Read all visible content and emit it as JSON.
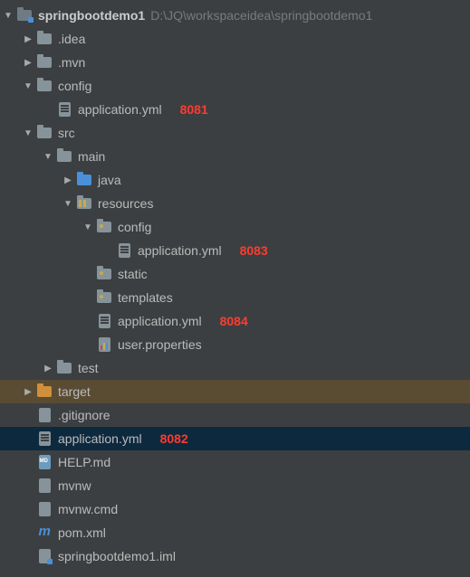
{
  "root": {
    "name": "springbootdemo1",
    "path": "D:\\JQ\\workspaceidea\\springbootdemo1"
  },
  "nodes": {
    "idea": ".idea",
    "mvn": ".mvn",
    "config": "config",
    "config_app_yml": "application.yml",
    "config_app_yml_port": "8081",
    "src": "src",
    "main": "main",
    "java": "java",
    "resources": "resources",
    "res_config": "config",
    "res_config_app_yml": "application.yml",
    "res_config_app_yml_port": "8083",
    "static": "static",
    "templates": "templates",
    "res_app_yml": "application.yml",
    "res_app_yml_port": "8084",
    "user_props": "user.properties",
    "test": "test",
    "target": "target",
    "gitignore": ".gitignore",
    "root_app_yml": "application.yml",
    "root_app_yml_port": "8082",
    "help_md": "HELP.md",
    "mvnw": "mvnw",
    "mvnw_cmd": "mvnw.cmd",
    "pom_xml": "pom.xml",
    "iml": "springbootdemo1.iml"
  }
}
